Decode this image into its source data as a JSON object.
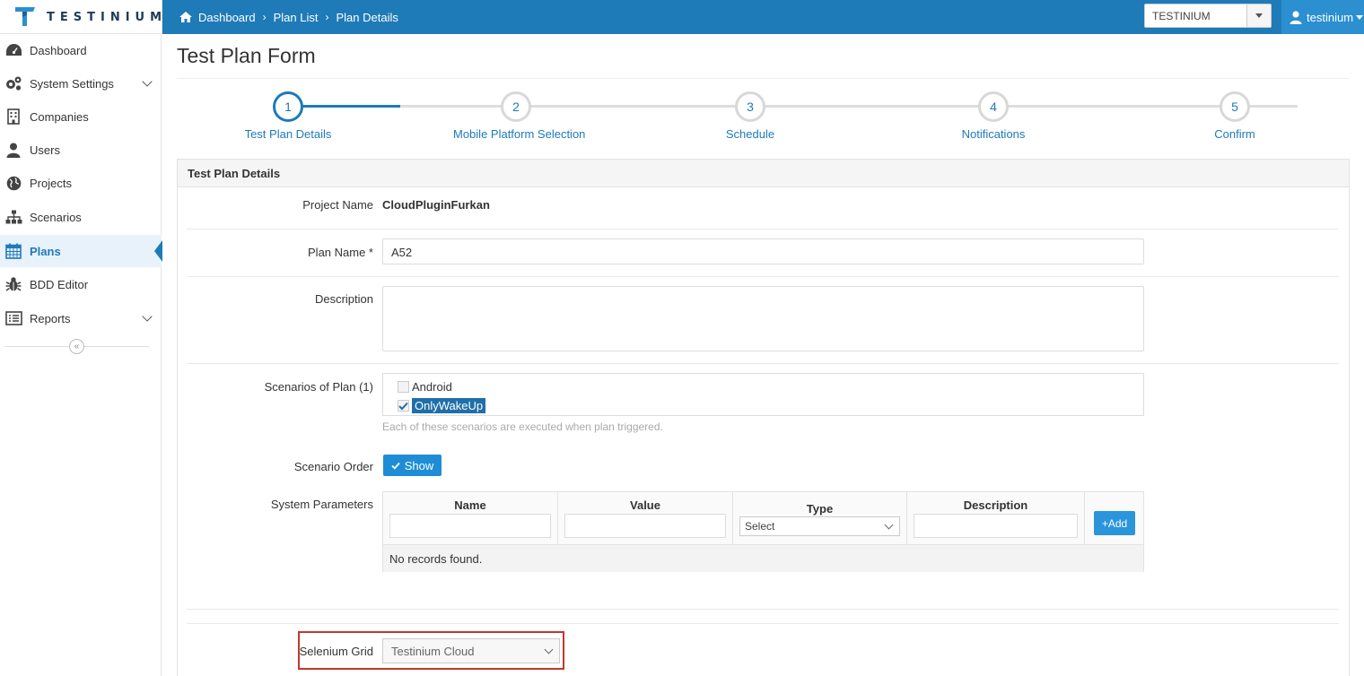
{
  "app": {
    "brand": "TESTINIUM"
  },
  "header": {
    "breadcrumb": [
      "Dashboard",
      "Plan List",
      "Plan Details"
    ],
    "company_select": "TESTINIUM",
    "user": "testinium"
  },
  "sidebar": {
    "items": [
      {
        "label": "Dashboard",
        "icon": "dashboard-icon"
      },
      {
        "label": "System Settings",
        "icon": "gears-icon",
        "expandable": true
      },
      {
        "label": "Companies",
        "icon": "building-icon"
      },
      {
        "label": "Users",
        "icon": "user-icon"
      },
      {
        "label": "Projects",
        "icon": "globe-icon"
      },
      {
        "label": "Scenarios",
        "icon": "sitemap-icon"
      },
      {
        "label": "Plans",
        "icon": "calendar-icon",
        "active": true
      },
      {
        "label": "BDD Editor",
        "icon": "bug-icon"
      },
      {
        "label": "Reports",
        "icon": "list-icon",
        "expandable": true
      }
    ],
    "collapse_glyph": "«"
  },
  "page": {
    "title": "Test Plan Form"
  },
  "wizard": {
    "steps": [
      {
        "num": "1",
        "label": "Test Plan Details",
        "active": true
      },
      {
        "num": "2",
        "label": "Mobile Platform Selection"
      },
      {
        "num": "3",
        "label": "Schedule"
      },
      {
        "num": "4",
        "label": "Notifications"
      },
      {
        "num": "5",
        "label": "Confirm"
      }
    ]
  },
  "form": {
    "panel_title": "Test Plan Details",
    "project_name_label": "Project Name",
    "project_name_value": "CloudPluginFurkan",
    "plan_name_label": "Plan Name *",
    "plan_name_value": "A52",
    "description_label": "Description",
    "description_value": "",
    "scenarios_label": "Scenarios of Plan (1)",
    "scenarios": [
      {
        "label": "Android",
        "checked": false
      },
      {
        "label": "OnlyWakeUp",
        "checked": true
      }
    ],
    "scenarios_hint": "Each of these scenarios are executed when plan triggered.",
    "scenario_order_label": "Scenario Order",
    "show_button": "Show",
    "system_parameters_label": "System Parameters",
    "params_columns": [
      "Name",
      "Value",
      "Type",
      "Description"
    ],
    "type_select_value": "Select",
    "add_button": "+Add",
    "no_records": "No records found.",
    "selenium_grid_label": "Selenium Grid",
    "selenium_grid_value": "Testinium Cloud"
  },
  "colors": {
    "primary": "#1f7ab8",
    "highlight": "#c0392b"
  }
}
